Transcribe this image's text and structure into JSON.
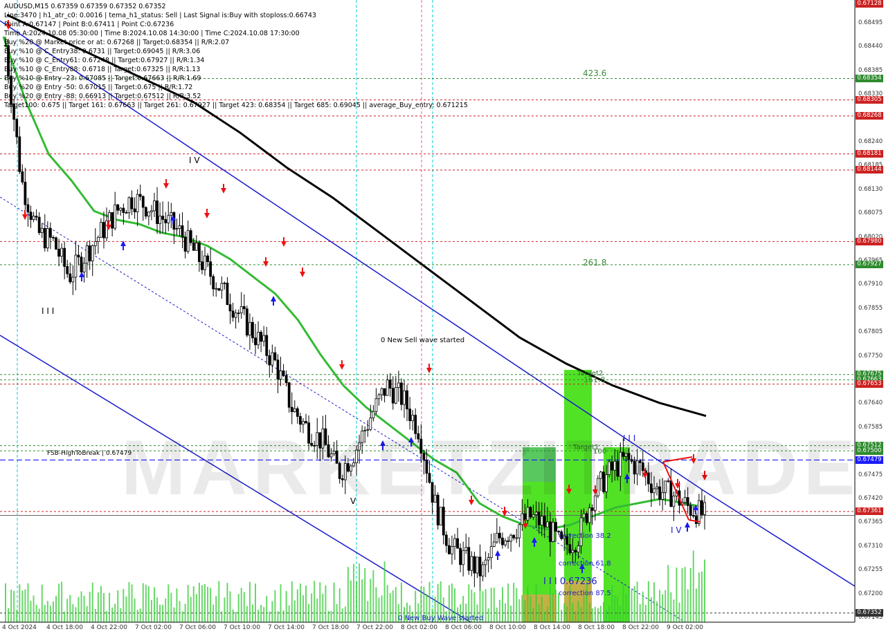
{
  "header": {
    "lines": [
      "AUDUSD,M15  0.67359 0.67359 0.67352 0.67352",
      "Line:3470  |  h1_atr_c0: 0.0016  |  tema_h1_status: Sell  |  Last Signal is:Buy with stoploss:0.66743",
      "Point A:0.67147  |  Point B:0.67411  |  Point C:0.67236",
      "Time A:2024.10.08 05:30:00  |  Time B:2024.10.08 14:30:00  |  Time C:2024.10.08 17:30:00",
      "Buy %20 @ Market price or at: 0.67268  ||  Target:0.68354  ||  R/R:2.07",
      "Buy %10 @ C_Entry38: 0.6731  ||  Target:0.69045  ||  R/R:3.06",
      "Buy %10 @ C_Entry61: 0.67248  ||  Target:0.67927  ||  R/R:1.34",
      "Buy %10 @ C_Entry88: 0.6718  ||  Target:0.67325  ||  R/R:1.13",
      "Buy %10 @ Entry -23: 0.67085  ||  Target:0.67663  ||  R/R:1.69",
      "Buy %20 @ Entry -50: 0.67015  ||  Target:0.675  ||  R/R:1.72",
      "Buy %20 @ Entry -88: 0.66913  ||  Target:0.67512  ||  R/R:3.52",
      "Target100: 0.675  ||  Target 161: 0.67663  ||  Target 261: 0.67927  ||  Target 423: 0.68354  ||  Target 685: 0.69045  ||  average_Buy_entry: 0.671215"
    ]
  },
  "watermark": "MARKETZITRADE",
  "price_axis": {
    "ticks": [
      "0.68495",
      "0.68440",
      "0.68385",
      "0.68330",
      "0.68275",
      "0.68240",
      "0.68185",
      "0.68130",
      "0.68075",
      "0.68020",
      "0.67965",
      "0.67910",
      "0.67855",
      "0.67805",
      "0.67750",
      "0.67695",
      "0.67640",
      "0.67585",
      "0.67530",
      "0.67475",
      "0.67420",
      "0.67365",
      "0.67310",
      "0.67255",
      "0.67200",
      "0.67145"
    ],
    "labels": [
      {
        "text": "0.68354",
        "color": "#2e8b2e"
      },
      {
        "text": "0.68305",
        "color": "#cc2222"
      },
      {
        "text": "0.68268",
        "color": "#cc2222"
      },
      {
        "text": "0.68181",
        "color": "#cc2222"
      },
      {
        "text": "0.68144",
        "color": "#cc2222"
      },
      {
        "text": "0.67980",
        "color": "#cc2222"
      },
      {
        "text": "0.67927",
        "color": "#2e8b2e"
      },
      {
        "text": "0.67675",
        "color": "#2e8b2e"
      },
      {
        "text": "0.67663",
        "color": "#2e8b2e"
      },
      {
        "text": "0.67653",
        "color": "#cc2222"
      },
      {
        "text": "0.67512",
        "color": "#2e8b2e"
      },
      {
        "text": "0.67500",
        "color": "#2e8b2e"
      },
      {
        "text": "0.67479",
        "color": "#1a1aff"
      },
      {
        "text": "0.67361",
        "color": "#cc2222"
      },
      {
        "text": "0.67352",
        "color": "#333333"
      },
      {
        "text": "0.67128",
        "color": "#cc2222"
      }
    ]
  },
  "time_axis": [
    "4 Oct 2024",
    "4 Oct 18:00",
    "4 Oct 22:00",
    "7 Oct 02:00",
    "7 Oct 06:00",
    "7 Oct 10:00",
    "7 Oct 14:00",
    "7 Oct 18:00",
    "7 Oct 22:00",
    "8 Oct 02:00",
    "8 Oct 06:00",
    "8 Oct 10:00",
    "8 Oct 14:00",
    "8 Oct 18:00",
    "8 Oct 22:00",
    "9 Oct 02:00"
  ],
  "annotations": {
    "fsb_label": "FSB-HighToBreak  |  0.67479",
    "t4236": "423.6",
    "t2618": "261.8",
    "t1618": "161.8",
    "target2": "Target2",
    "target1": "Target1",
    "t100": "100",
    "sell_wave": "0 New Sell wave started",
    "buy_wave": "0 New Buy Wave started",
    "corr382": "correction 38.2",
    "corr618": "correction 61.8",
    "corr875": "correction 87.5",
    "point_c": "I I I 0.67236",
    "w_iii": "I I I",
    "w_iv": "I V",
    "w_v": "V",
    "w_iii2": "I I I",
    "w_iv2": "I V"
  },
  "colors": {
    "bull_candle": "#000000",
    "ma_green": "#33bb33",
    "ma_black": "#000000",
    "channel": "#1a1acc",
    "target_green": "#2e8b2e",
    "stop_red": "#cc2222",
    "volume": "#33cc33",
    "zone_green": "#33dd00",
    "zone_orange": "#e8a050"
  },
  "chart_data": {
    "type": "candlestick",
    "symbol": "AUDUSD",
    "timeframe": "M15",
    "last_price": 0.67352,
    "fsb_high_to_break": 0.67479,
    "y_range": [
      0.67115,
      0.68515
    ],
    "horizontal_levels": [
      0.68354,
      0.68305,
      0.68268,
      0.68181,
      0.68144,
      0.6798,
      0.67927,
      0.67675,
      0.67663,
      0.67653,
      0.67512,
      0.675,
      0.67479,
      0.67361,
      0.67128
    ],
    "key_points": [
      {
        "label": "Point A",
        "time": "2024.10.08 05:30:00",
        "price": 0.67147
      },
      {
        "label": "Point B",
        "time": "2024.10.08 14:30:00",
        "price": 0.67411
      },
      {
        "label": "Point C",
        "time": "2024.10.08 17:30:00",
        "price": 0.67236
      }
    ],
    "close_path": [
      0.6843,
      0.6812,
      0.68,
      0.6798,
      0.679,
      0.6795,
      0.68,
      0.6805,
      0.6808,
      0.6806,
      0.6803,
      0.68,
      0.6795,
      0.679,
      0.6785,
      0.678,
      0.6775,
      0.677,
      0.676,
      0.6755,
      0.6752,
      0.6745,
      0.675,
      0.6758,
      0.6765,
      0.6762,
      0.6755,
      0.6738,
      0.6728,
      0.6725,
      0.6722,
      0.673,
      0.6732,
      0.6735,
      0.6733,
      0.6728,
      0.673,
      0.674,
      0.6745,
      0.6748,
      0.6746,
      0.6741,
      0.674,
      0.6737,
      0.67352
    ],
    "ma_fast": [
      0.6845,
      0.683,
      0.6818,
      0.6812,
      0.6805,
      0.6803,
      0.6802,
      0.68,
      0.6799,
      0.6797,
      0.6794,
      0.679,
      0.6786,
      0.678,
      0.6772,
      0.6765,
      0.676,
      0.6756,
      0.6752,
      0.6748,
      0.6745,
      0.6738,
      0.6735,
      0.6733,
      0.6732,
      0.6733,
      0.6735,
      0.6737,
      0.6738,
      0.6739,
      0.6738,
      0.6737
    ],
    "ma_slow": [
      0.685,
      0.6845,
      0.684,
      0.6835,
      0.683,
      0.6823,
      0.6815,
      0.6808,
      0.68,
      0.6792,
      0.6784,
      0.6776,
      0.677,
      0.6765,
      0.6761,
      0.6758
    ]
  }
}
